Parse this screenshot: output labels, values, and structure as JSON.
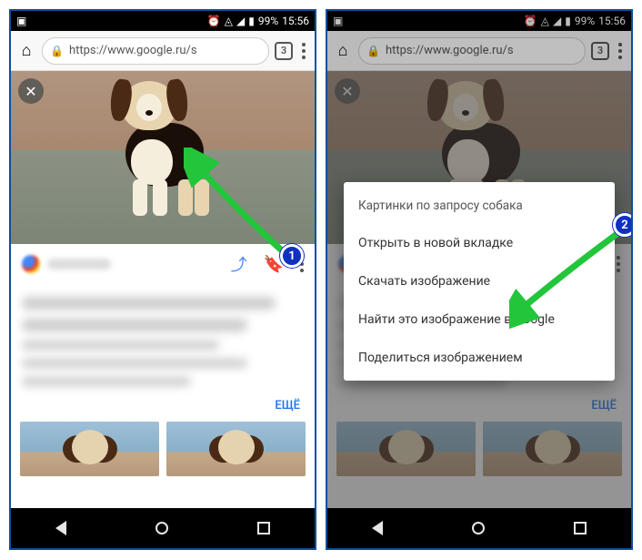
{
  "status": {
    "battery": "99%",
    "time": "15:56"
  },
  "chrome": {
    "url": "https://www.google.ru/s",
    "tab_count": "3"
  },
  "card": {
    "more_label": "ЕЩЁ"
  },
  "context_menu": {
    "title": "Картинки по запросу собака",
    "items": [
      "Открыть в новой вкладке",
      "Скачать изображение",
      "Найти это изображение в Google",
      "Поделиться изображением"
    ]
  },
  "steps": {
    "one": "1",
    "two": "2"
  }
}
